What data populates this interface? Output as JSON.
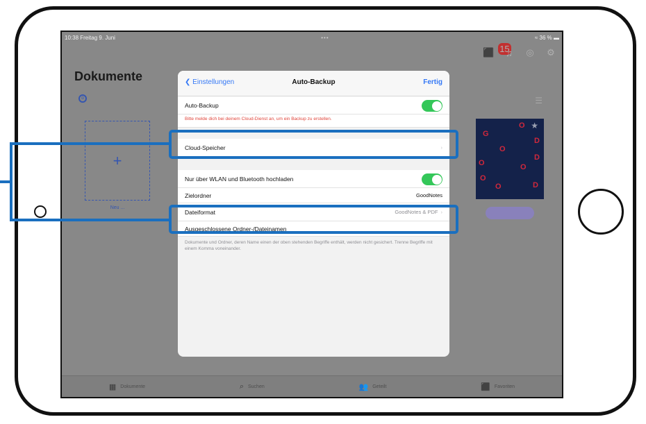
{
  "status": {
    "time_date": "10:38  Freitag 9. Juni",
    "dots": "•••",
    "battery": "36 %"
  },
  "header": {
    "title": "Dokumente",
    "badge_count": "15"
  },
  "library": {
    "new_label": "Neu ...",
    "plus": "+"
  },
  "notebook": {
    "letters": [
      "G",
      "O",
      "D",
      "O",
      "D",
      "O",
      "O",
      "O",
      "O",
      "D"
    ]
  },
  "tabbar": {
    "items": [
      {
        "label": "Dokumente",
        "icon": "grid-icon"
      },
      {
        "label": "Suchen",
        "icon": "search-icon"
      },
      {
        "label": "Geteilt",
        "icon": "people-icon"
      },
      {
        "label": "Favoriten",
        "icon": "bookmark-icon"
      }
    ]
  },
  "modal": {
    "back_label": "Einstellungen",
    "title": "Auto-Backup",
    "done_label": "Fertig",
    "auto_backup_label": "Auto-Backup",
    "auto_backup_on": true,
    "warning": "Bitte melde dich bei deinem Cloud-Dienst an, um ein Backup zu erstellen.",
    "cloud_label": "Cloud-Speicher",
    "wifi_label": "Nur über WLAN und Bluetooth hochladen",
    "wifi_on": true,
    "folder_label": "Zielordner",
    "folder_value": "GoodNotes",
    "format_label": "Dateiformat",
    "format_value": "GoodNotes & PDF",
    "excluded_label": "Ausgeschlossene Ordner-/Dateinamen",
    "excluded_note": "Dokumente und Ordner, deren Name einen der oben stehenden Begriffe enthält, werden nicht gesichert. Trenne Begriffe mit einem Komma voneinander."
  },
  "colors": {
    "accent": "#3478f6",
    "toggle_on": "#34c759",
    "callout": "#1a6fbf",
    "warning": "#e0443a"
  }
}
